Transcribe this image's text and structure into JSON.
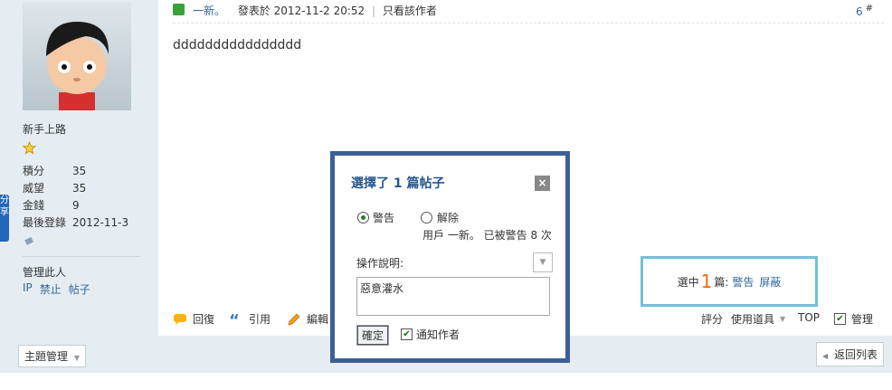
{
  "user": {
    "rank": "新手上路",
    "stats": [
      {
        "label": "積分",
        "value": "35"
      },
      {
        "label": "威望",
        "value": "35"
      },
      {
        "label": "金錢",
        "value": "9"
      },
      {
        "label": "最後登錄",
        "value": "2012-11-3"
      }
    ],
    "manage_label": "管理此人",
    "manage_links": [
      "IP",
      "禁止",
      "帖子"
    ],
    "share_label": "分享"
  },
  "post": {
    "author": "一新。",
    "posted_at": "發表於 2012-11-2 20:52",
    "only_author": "只看該作者",
    "floor": "6",
    "floor_suffix": "#",
    "body": "dddddddddddddddd"
  },
  "actions": {
    "reply": "回復",
    "quote": "引用",
    "edit": "編輯",
    "rate": "評分",
    "tools": "使用道具",
    "top": "TOP",
    "manage": "管理"
  },
  "bottom": {
    "thread_manage": "主題管理",
    "back_to_list": "返回列表"
  },
  "selection": {
    "prefix": "選中",
    "count": "1",
    "suffix": "篇:",
    "warn": "警告",
    "mask": "屏蔽"
  },
  "dialog": {
    "title": "選擇了 1 篇帖子",
    "close": "×",
    "option_warn": "警告",
    "option_unwarn": "解除",
    "warn_status": "用戶 一新。 已被警告 8 次",
    "reason_label": "操作說明:",
    "reason_value": "惡意灌水",
    "confirm": "確定",
    "notify": "通知作者"
  },
  "colors": {
    "accent": "#336699",
    "dialog_border": "#3e5f96",
    "selection_border": "#74bfd6",
    "count_orange": "#f26c00"
  }
}
